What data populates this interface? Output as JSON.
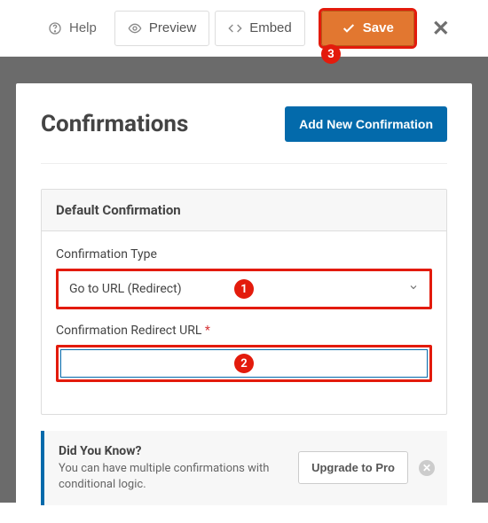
{
  "topbar": {
    "help": "Help",
    "preview": "Preview",
    "embed": "Embed",
    "save": "Save"
  },
  "badges": {
    "one": "1",
    "two": "2",
    "three": "3"
  },
  "panel": {
    "title": "Confirmations",
    "add_button": "Add New Confirmation"
  },
  "card": {
    "title": "Default Confirmation",
    "type_label": "Confirmation Type",
    "type_value": "Go to URL (Redirect)",
    "url_label": "Confirmation Redirect URL",
    "url_required": "*",
    "url_value": ""
  },
  "tip": {
    "heading": "Did You Know?",
    "body": "You can have multiple confirmations with conditional logic.",
    "upgrade": "Upgrade to Pro"
  }
}
